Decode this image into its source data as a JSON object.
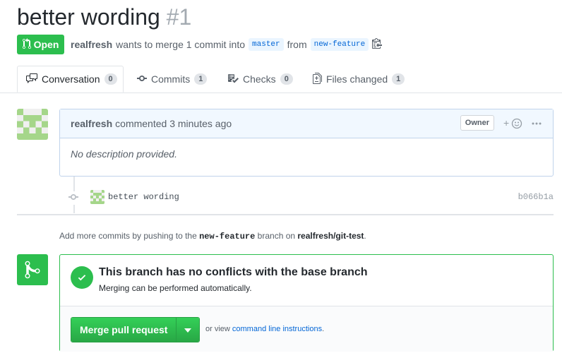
{
  "pr": {
    "title": "better wording",
    "number": "#1",
    "state": "Open",
    "author": "realfresh",
    "merge_text": "wants to merge 1 commit into",
    "base_branch": "master",
    "from_text": "from",
    "head_branch": "new-feature"
  },
  "tabs": [
    {
      "label": "Conversation",
      "count": "0",
      "icon": "comment-discussion-icon"
    },
    {
      "label": "Commits",
      "count": "1",
      "icon": "git-commit-icon"
    },
    {
      "label": "Checks",
      "count": "0",
      "icon": "checklist-icon"
    },
    {
      "label": "Files changed",
      "count": "1",
      "icon": "file-diff-icon"
    }
  ],
  "comment": {
    "author": "realfresh",
    "action": "commented 3 minutes ago",
    "badge": "Owner",
    "reaction_icon": "smiley-icon",
    "more_icon": "kebab-icon",
    "body": "No description provided."
  },
  "commit": {
    "message": "better wording",
    "sha": "b066b1a"
  },
  "push_hint": {
    "prefix": "Add more commits by pushing to the",
    "branch": "new-feature",
    "middle": "branch on",
    "repo": "realfresh/git-test",
    "suffix": "."
  },
  "merge": {
    "title": "This branch has no conflicts with the base branch",
    "subtitle": "Merging can be performed automatically.",
    "button_label": "Merge pull request",
    "alt_prefix": "or view",
    "alt_link": "command line instructions",
    "alt_suffix": "."
  },
  "colors": {
    "green": "#2cbe4e",
    "link": "#0366d6",
    "border_blue": "#c0d3eb"
  }
}
